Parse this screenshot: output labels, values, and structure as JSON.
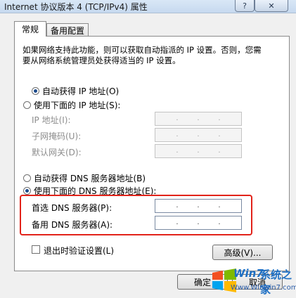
{
  "window": {
    "title": "Internet 协议版本 4 (TCP/IPv4) 属性",
    "help_glyph": "?",
    "close_glyph": "✕"
  },
  "tabs": [
    {
      "label": "常规",
      "active": true
    },
    {
      "label": "备用配置",
      "active": false
    }
  ],
  "description": "如果网络支持此功能，则可以获取自动指派的 IP 设置。否则，您需要从网络系统管理员处获得适当的 IP 设置。",
  "ip": {
    "auto_label": "自动获得 IP 地址(O)",
    "manual_label": "使用下面的 IP 地址(S):",
    "selected": "auto",
    "fields": [
      {
        "label": "IP 地址(I):",
        "value": ". . ."
      },
      {
        "label": "子网掩码(U):",
        "value": ". . ."
      },
      {
        "label": "默认网关(D):",
        "value": ". . ."
      }
    ]
  },
  "dns": {
    "auto_label": "自动获得 DNS 服务器地址(B)",
    "manual_label": "使用下面的 DNS 服务器地址(E):",
    "selected": "manual",
    "fields": [
      {
        "label": "首选 DNS 服务器(P):",
        "value": ". . ."
      },
      {
        "label": "备用 DNS 服务器(A):",
        "value": ". . ."
      }
    ]
  },
  "validate_label": "退出时验证设置(L)",
  "validate_checked": false,
  "buttons": {
    "advanced": "高级(V)...",
    "ok": "确定",
    "cancel": "取消"
  },
  "watermark": {
    "brand": "Win7",
    "site_name": "系统之家",
    "url": "Www.Winwin7.com"
  },
  "colors": {
    "highlight": "#e2231a",
    "radio_dot": "#1b4a8b"
  }
}
